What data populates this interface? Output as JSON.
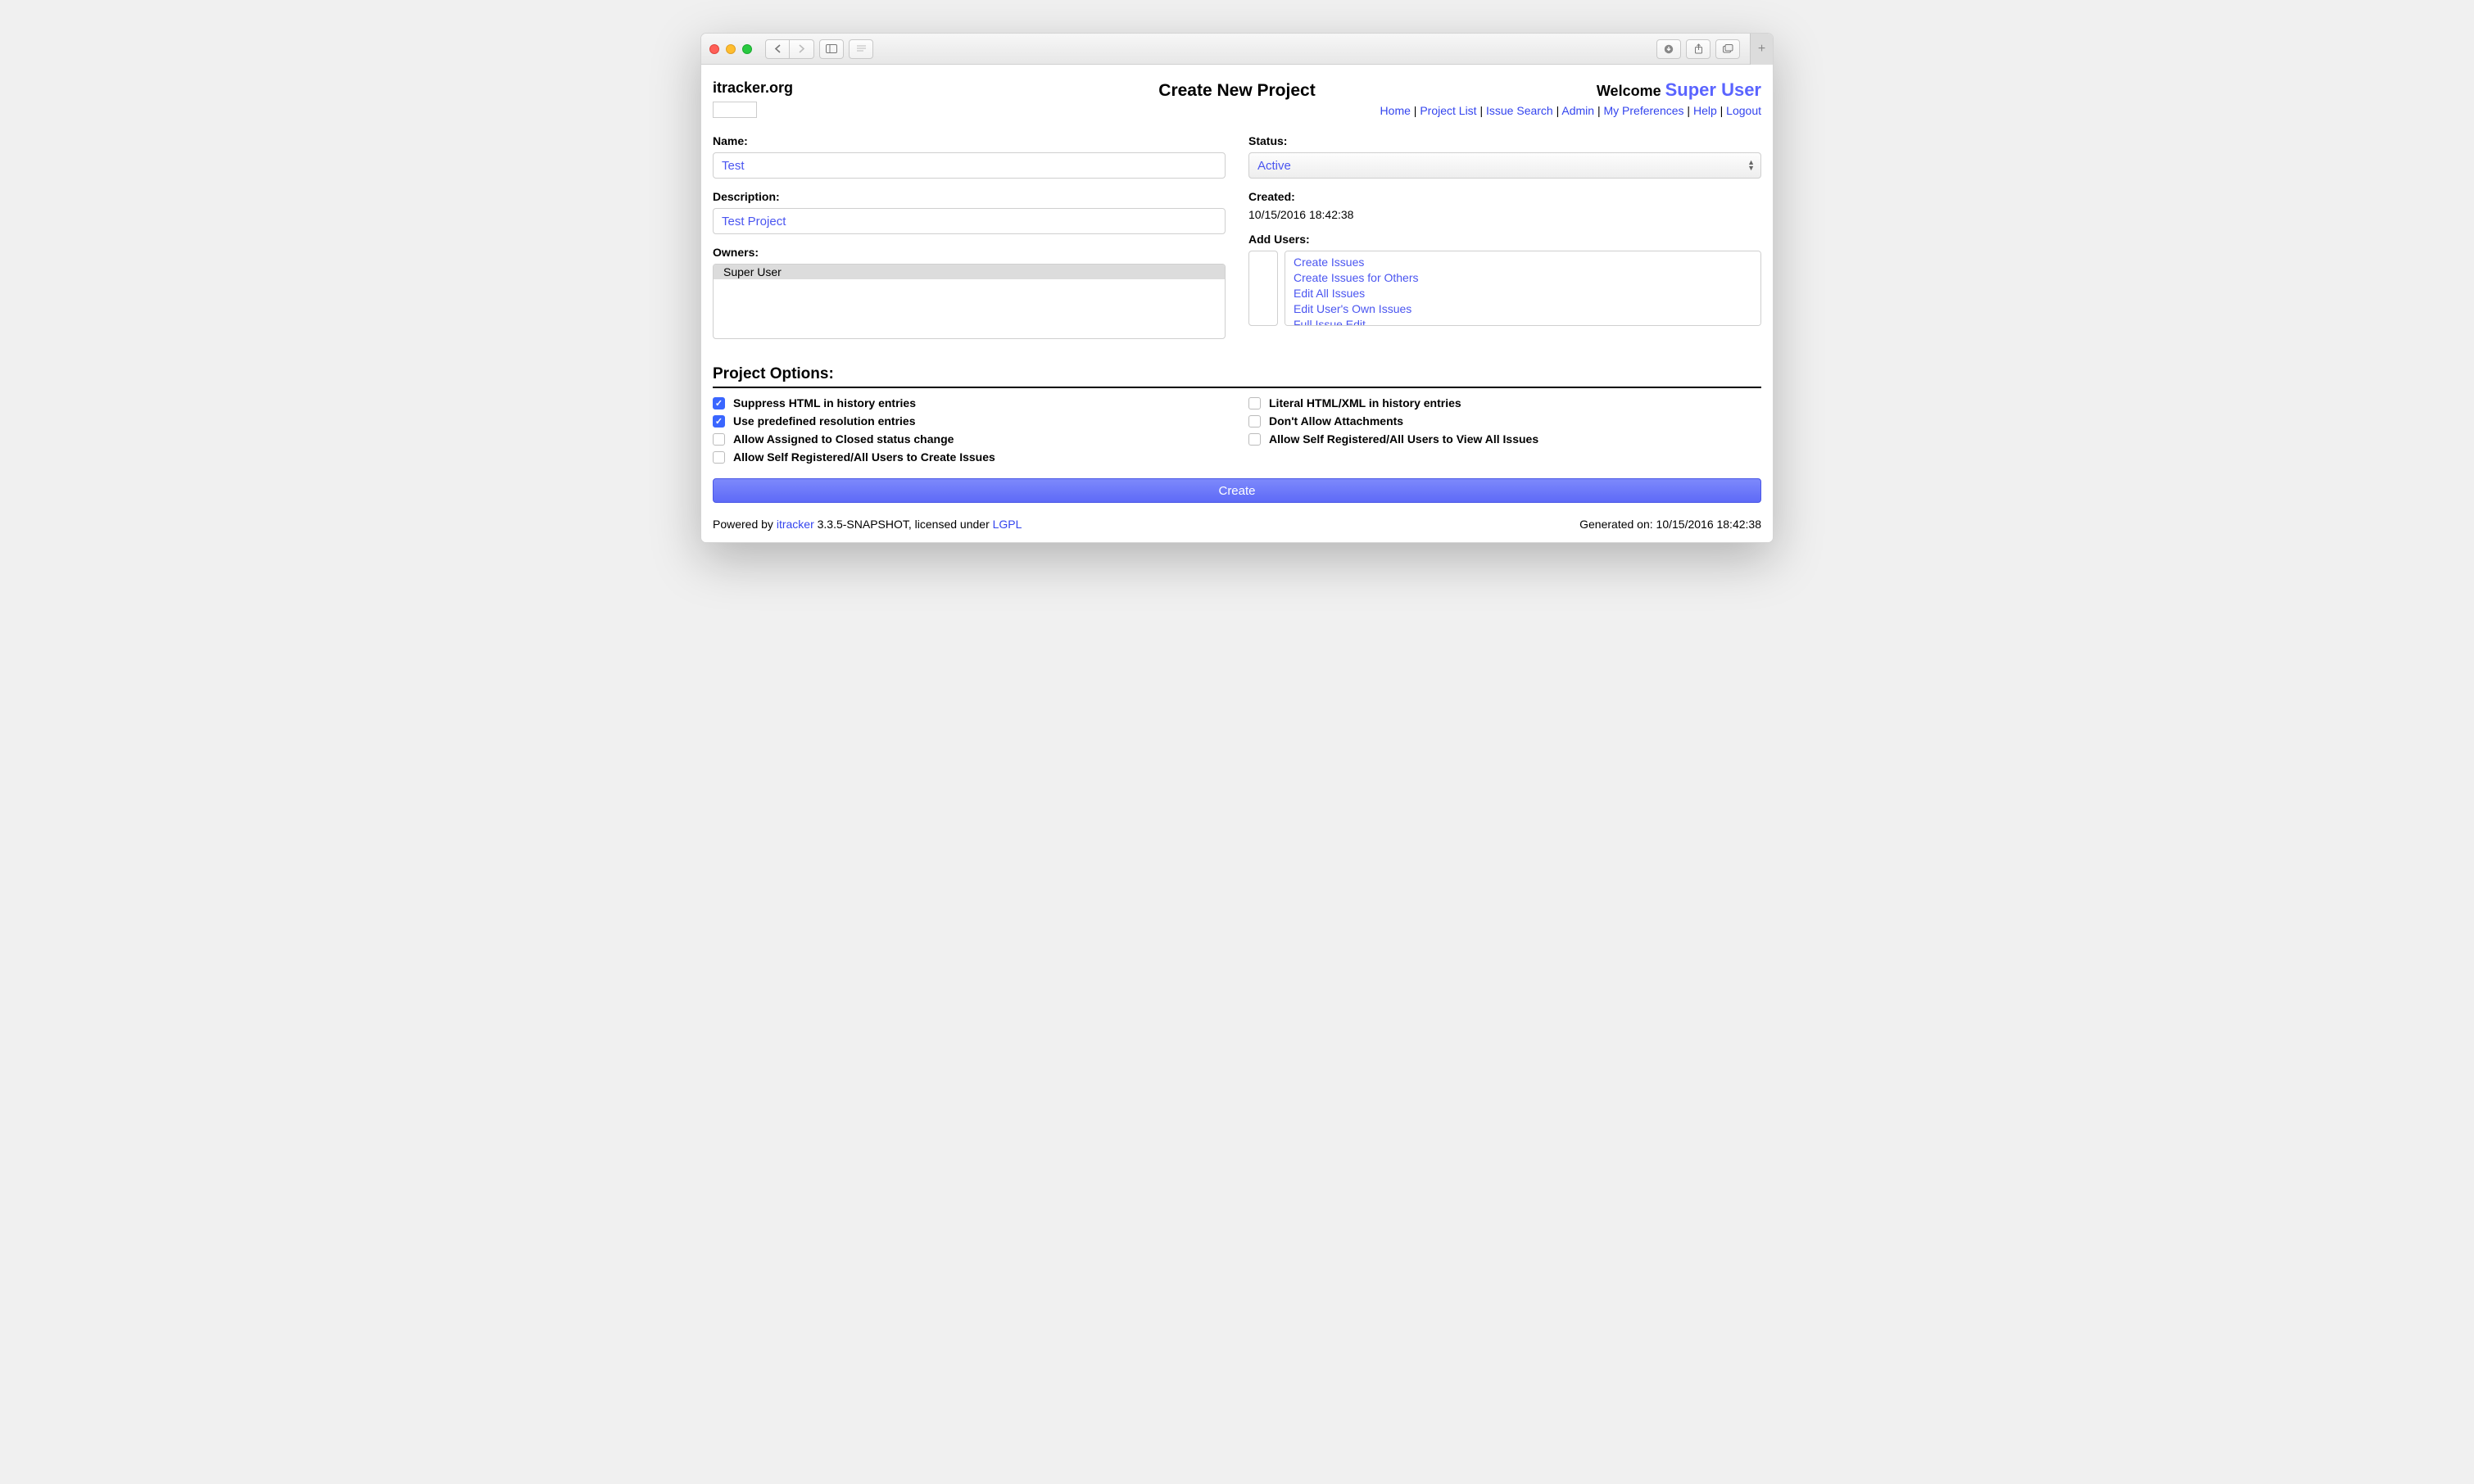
{
  "brand": "itracker.org",
  "page_title": "Create New Project",
  "welcome_label": "Welcome",
  "welcome_user": "Super User",
  "nav": {
    "home": "Home",
    "project_list": "Project List",
    "issue_search": "Issue Search",
    "admin": "Admin",
    "my_prefs": "My Preferences",
    "help": "Help",
    "logout": "Logout"
  },
  "form": {
    "name_label": "Name:",
    "name_value": "Test",
    "status_label": "Status:",
    "status_value": "Active",
    "description_label": "Description:",
    "description_value": "Test Project",
    "created_label": "Created:",
    "created_value": "10/15/2016 18:42:38",
    "owners_label": "Owners:",
    "owners": [
      "Super User"
    ],
    "addusers_label": "Add Users:",
    "permissions": [
      "Create Issues",
      "Create Issues for Others",
      "Edit All Issues",
      "Edit User's Own Issues",
      "Full Issue Edit"
    ]
  },
  "options_title": "Project Options:",
  "options_left": [
    {
      "label": "Suppress HTML in history entries",
      "checked": true
    },
    {
      "label": "Use predefined resolution entries",
      "checked": true
    },
    {
      "label": "Allow Assigned to Closed status change",
      "checked": false
    },
    {
      "label": "Allow Self Registered/All Users to Create Issues",
      "checked": false
    }
  ],
  "options_right": [
    {
      "label": "Literal HTML/XML in history entries",
      "checked": false
    },
    {
      "label": "Don't Allow Attachments",
      "checked": false
    },
    {
      "label": "Allow Self Registered/All Users to View All Issues",
      "checked": false
    }
  ],
  "create_btn": "Create",
  "footer": {
    "powered_by": "Powered by ",
    "app_name": "itracker",
    "version_text": " 3.3.5-SNAPSHOT, licensed under ",
    "license": "LGPL",
    "generated_label": "Generated on: ",
    "generated_value": "10/15/2016 18:42:38"
  }
}
